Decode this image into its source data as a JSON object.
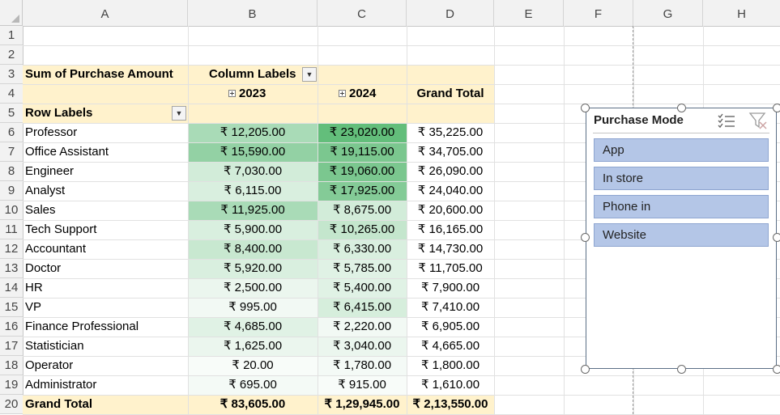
{
  "columns": [
    "A",
    "B",
    "C",
    "D",
    "E",
    "F",
    "G",
    "H"
  ],
  "rows": [
    "1",
    "2",
    "3",
    "4",
    "5",
    "6",
    "7",
    "8",
    "9",
    "10",
    "11",
    "12",
    "13",
    "14",
    "15",
    "16",
    "17",
    "18",
    "19",
    "20"
  ],
  "pivot": {
    "title": "Sum of Purchase Amount",
    "column_labels": "Column Labels",
    "row_labels": "Row Labels",
    "year1": "2023",
    "year2": "2024",
    "grand_total_header": "Grand Total",
    "data": [
      {
        "label": "Professor",
        "y2023": "₹ 12,205.00",
        "y2024": "₹ 23,020.00",
        "total": "₹ 35,225.00"
      },
      {
        "label": "Office Assistant",
        "y2023": "₹ 15,590.00",
        "y2024": "₹ 19,115.00",
        "total": "₹ 34,705.00"
      },
      {
        "label": "Engineer",
        "y2023": "₹ 7,030.00",
        "y2024": "₹ 19,060.00",
        "total": "₹ 26,090.00"
      },
      {
        "label": "Analyst",
        "y2023": "₹ 6,115.00",
        "y2024": "₹ 17,925.00",
        "total": "₹ 24,040.00"
      },
      {
        "label": "Sales",
        "y2023": "₹ 11,925.00",
        "y2024": "₹ 8,675.00",
        "total": "₹ 20,600.00"
      },
      {
        "label": "Tech Support",
        "y2023": "₹ 5,900.00",
        "y2024": "₹ 10,265.00",
        "total": "₹ 16,165.00"
      },
      {
        "label": "Accountant",
        "y2023": "₹ 8,400.00",
        "y2024": "₹ 6,330.00",
        "total": "₹ 14,730.00"
      },
      {
        "label": "Doctor",
        "y2023": "₹ 5,920.00",
        "y2024": "₹ 5,785.00",
        "total": "₹ 11,705.00"
      },
      {
        "label": "HR",
        "y2023": "₹ 2,500.00",
        "y2024": "₹ 5,400.00",
        "total": "₹ 7,900.00"
      },
      {
        "label": "VP",
        "y2023": "₹ 995.00",
        "y2024": "₹ 6,415.00",
        "total": "₹ 7,410.00"
      },
      {
        "label": "Finance Professional",
        "y2023": "₹ 4,685.00",
        "y2024": "₹ 2,220.00",
        "total": "₹ 6,905.00"
      },
      {
        "label": "Statistician",
        "y2023": "₹ 1,625.00",
        "y2024": "₹ 3,040.00",
        "total": "₹ 4,665.00"
      },
      {
        "label": "Operator",
        "y2023": "₹ 20.00",
        "y2024": "₹ 1,780.00",
        "total": "₹ 1,800.00"
      },
      {
        "label": "Administrator",
        "y2023": "₹ 695.00",
        "y2024": "₹ 915.00",
        "total": "₹ 1,610.00"
      }
    ],
    "grand_total_row": {
      "label": "Grand Total",
      "y2023": "₹ 83,605.00",
      "y2024": "₹ 1,29,945.00",
      "total": "₹ 2,13,550.00"
    },
    "heat_colors": {
      "y2023": [
        "#a9dbb7",
        "#93d1a4",
        "#d2ecd9",
        "#d9efdf",
        "#a9dbb7",
        "#d9efdf",
        "#c8e8d0",
        "#d9efdf",
        "#ebf6ee",
        "#f2f9f4",
        "#e0f2e5",
        "#ebf6ee",
        "#f8fcf9",
        "#f4faf6"
      ],
      "y2024": [
        "#63be7b",
        "#7bc78f",
        "#7bc78f",
        "#84cb97",
        "#d2ecd9",
        "#c4e6cd",
        "#d9efdf",
        "#e0f2e5",
        "#e0f2e5",
        "#d6eedc",
        "#f2f9f4",
        "#ebf6ee",
        "#f4faf6",
        "#f8fcf9"
      ]
    },
    "header_bg": "#fff2cc"
  },
  "slicer": {
    "title": "Purchase Mode",
    "items": [
      "App",
      "In store",
      "Phone in",
      "Website"
    ],
    "multi_select_icon": "multi-select-icon",
    "clear_filter_icon": "clear-filter-icon",
    "item_color": "#b4c6e7"
  }
}
